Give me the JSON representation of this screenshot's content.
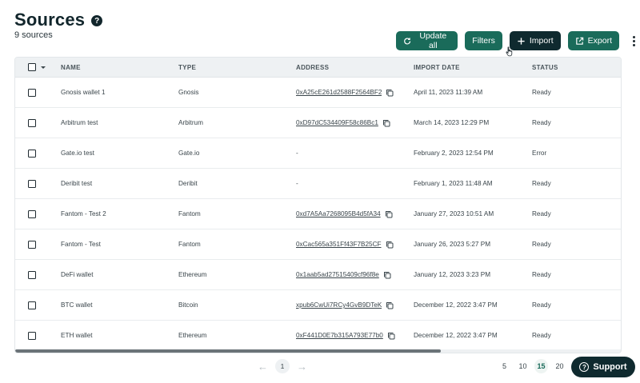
{
  "header": {
    "title": "Sources",
    "subtitle": "9 sources",
    "help_icon": "?"
  },
  "toolbar": {
    "update_label": "Update all",
    "filters_label": "Filters",
    "import_label": "Import",
    "export_label": "Export"
  },
  "table": {
    "columns": {
      "name": "NAME",
      "type": "TYPE",
      "address": "ADDRESS",
      "import_date": "IMPORT DATE",
      "status": "STATUS"
    },
    "rows": [
      {
        "name": "Gnosis wallet 1",
        "type": "Gnosis",
        "address": "0xA25cE261d2588F2564BF2",
        "date": "April 11, 2023 11:39 AM",
        "status": "Ready"
      },
      {
        "name": "Arbitrum test",
        "type": "Arbitrum",
        "address": "0xD97dC534409F58c86Bc1",
        "date": "March 14, 2023 12:29 PM",
        "status": "Ready"
      },
      {
        "name": "Gate.io test",
        "type": "Gate.io",
        "address": "-",
        "date": "February 2, 2023 12:54 PM",
        "status": "Error"
      },
      {
        "name": "Deribit test",
        "type": "Deribit",
        "address": "-",
        "date": "February 1, 2023 11:48 AM",
        "status": "Ready"
      },
      {
        "name": "Fantom - Test 2",
        "type": "Fantom",
        "address": "0xd7A5Aa7268095B4d5fA34",
        "date": "January 27, 2023 10:51 AM",
        "status": "Ready"
      },
      {
        "name": "Fantom - Test",
        "type": "Fantom",
        "address": "0xCac565a351Ff43F7B25CF",
        "date": "January 26, 2023 5:27 PM",
        "status": "Ready"
      },
      {
        "name": "DeFi wallet",
        "type": "Ethereum",
        "address": "0x1aab5ad27515409cf96f8e",
        "date": "January 12, 2023 3:23 PM",
        "status": "Ready"
      },
      {
        "name": "BTC wallet",
        "type": "Bitcoin",
        "address": "xpub6CwUi7RCy4GvB9DTeK",
        "date": "December 12, 2022 3:47 PM",
        "status": "Ready"
      },
      {
        "name": "ETH wallet",
        "type": "Ethereum",
        "address": "0xF441D0E7b315A793E77b0",
        "date": "December 12, 2022 3:47 PM",
        "status": "Ready"
      }
    ]
  },
  "pagination": {
    "current_page": "1",
    "prev_arrow": "←",
    "next_arrow": "→",
    "page_sizes": [
      "5",
      "10",
      "15",
      "20"
    ],
    "active_size": "15"
  },
  "support": {
    "label": "Support",
    "icon_glyph": "?"
  },
  "colors": {
    "primary": "#1a6b5a",
    "dark": "#0f2a2f"
  }
}
